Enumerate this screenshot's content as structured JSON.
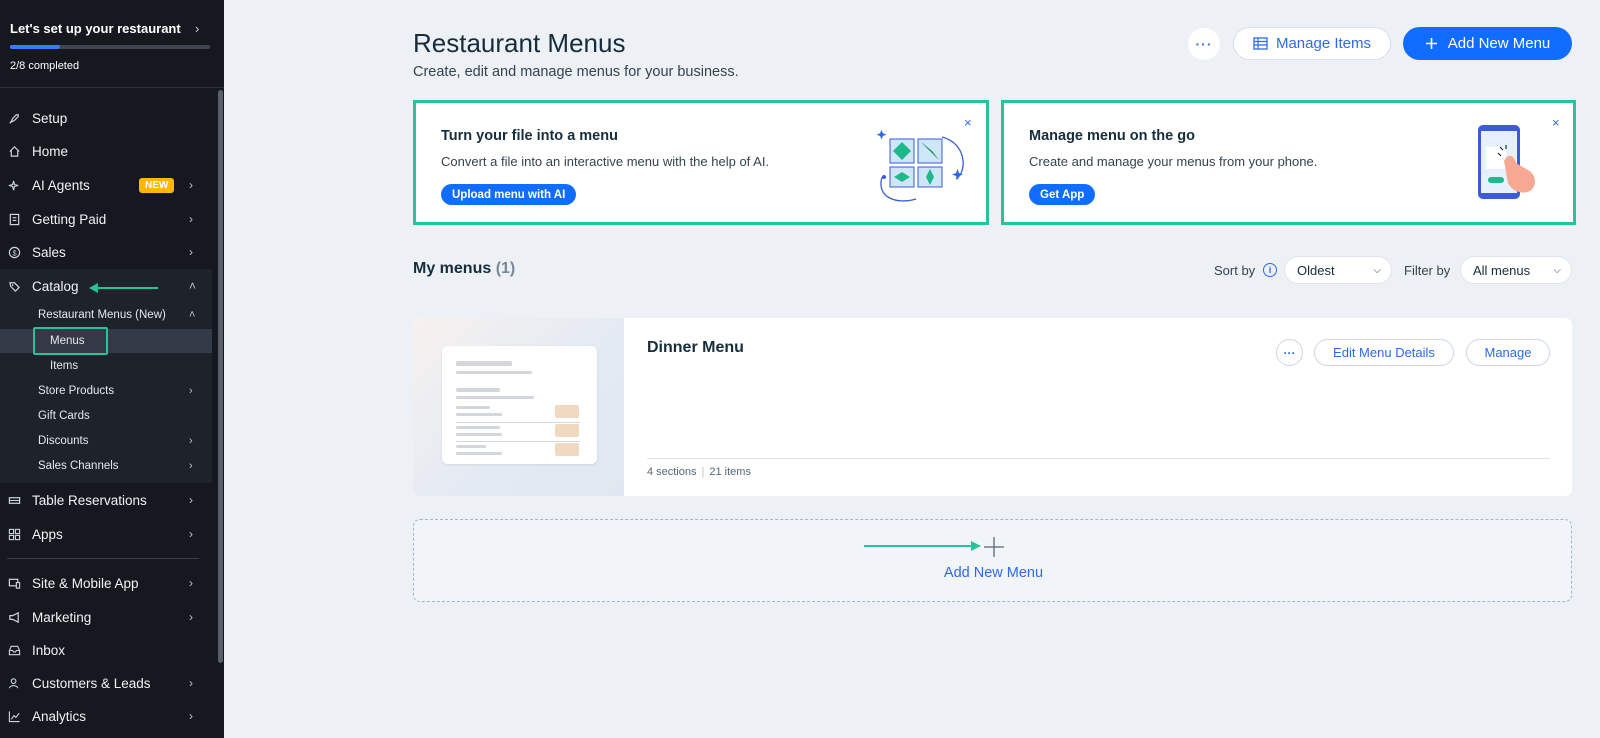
{
  "setup": {
    "title": "Let's set up your restaurant",
    "completed_text": "2/8 completed",
    "progress": 0.25
  },
  "sidebar": {
    "items": [
      {
        "label": "Setup",
        "icon": "rocket-icon"
      },
      {
        "label": "Home",
        "icon": "home-icon"
      },
      {
        "label": "AI Agents",
        "icon": "sparkle-icon",
        "badge": "NEW"
      },
      {
        "label": "Getting Paid",
        "icon": "invoice-icon"
      },
      {
        "label": "Sales",
        "icon": "dollar-icon"
      },
      {
        "label": "Catalog",
        "icon": "tag-icon"
      },
      {
        "label": "Table Reservations",
        "icon": "table-icon"
      },
      {
        "label": "Apps",
        "icon": "apps-icon"
      },
      {
        "label": "Site & Mobile App",
        "icon": "devices-icon"
      },
      {
        "label": "Marketing",
        "icon": "megaphone-icon"
      },
      {
        "label": "Inbox",
        "icon": "inbox-icon"
      },
      {
        "label": "Customers & Leads",
        "icon": "people-icon"
      },
      {
        "label": "Analytics",
        "icon": "chart-icon"
      }
    ],
    "catalog_sub": [
      {
        "label": "Restaurant Menus (New)"
      },
      {
        "label": "Menus"
      },
      {
        "label": "Items"
      },
      {
        "label": "Store Products"
      },
      {
        "label": "Gift Cards"
      },
      {
        "label": "Discounts"
      },
      {
        "label": "Sales Channels"
      }
    ]
  },
  "header": {
    "title": "Restaurant Menus",
    "subtitle": "Create, edit and manage menus for your business.",
    "more_label": "···",
    "manage_items_label": "Manage Items",
    "add_new_menu_label": "Add New Menu"
  },
  "promo_cards": [
    {
      "title": "Turn your file into a menu",
      "description": "Convert a file into an interactive menu with the help of AI.",
      "button": "Upload menu with AI",
      "close": "×"
    },
    {
      "title": "Manage menu on the go",
      "description": "Create and manage your menus from your phone.",
      "button": "Get App",
      "close": "×"
    }
  ],
  "my_menus": {
    "title": "My menus",
    "count": "(1)",
    "sort_label": "Sort by",
    "sort_value": "Oldest",
    "filter_label": "Filter by",
    "filter_value": "All menus"
  },
  "menu_card": {
    "name": "Dinner Menu",
    "more_label": "···",
    "edit_label": "Edit Menu Details",
    "manage_label": "Manage",
    "sections": "4 sections",
    "items": "21 items",
    "separator": "|"
  },
  "add_box": {
    "label": "Add New Menu"
  },
  "colors": {
    "accent": "#116dff",
    "highlight": "#25c49a",
    "sidebar_bg": "#15181f",
    "badge": "#ffb700"
  }
}
